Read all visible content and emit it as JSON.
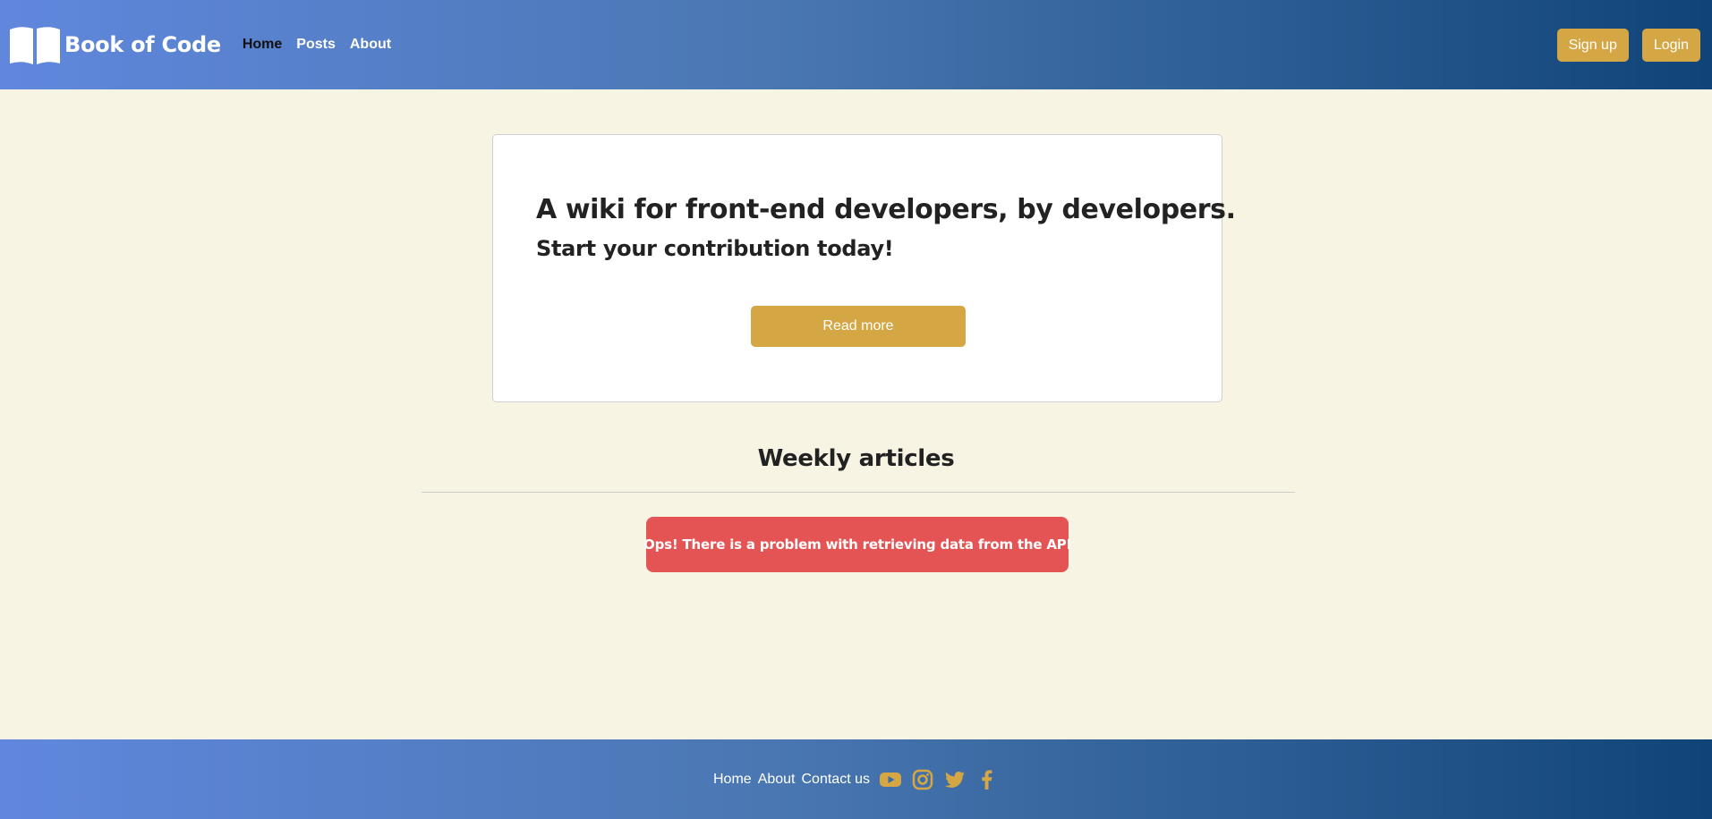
{
  "colors": {
    "accent": "#d4a744",
    "header_gradient_start": "#6087dd",
    "header_gradient_end": "#104478",
    "page_background": "#f8f4e3",
    "error": "#e45454",
    "active_nav": "#111111"
  },
  "header": {
    "logo_icon": "open-book-icon",
    "brand": "Book of Code",
    "nav": [
      {
        "label": "Home",
        "active": true
      },
      {
        "label": "Posts",
        "active": false
      },
      {
        "label": "About",
        "active": false
      }
    ],
    "signup_label": "Sign up",
    "login_label": "Login"
  },
  "hero": {
    "title": "A wiki for front-end developers, by developers.",
    "subtitle": "Start your contribution today!",
    "button_label": "Read more"
  },
  "articles": {
    "title": "Weekly articles",
    "error_message": "Ops! There is a problem with retrieving data from the API"
  },
  "footer": {
    "links": [
      "Home",
      "About",
      "Contact us"
    ],
    "social_icons": [
      "youtube-icon",
      "instagram-icon",
      "twitter-icon",
      "facebook-icon"
    ]
  }
}
